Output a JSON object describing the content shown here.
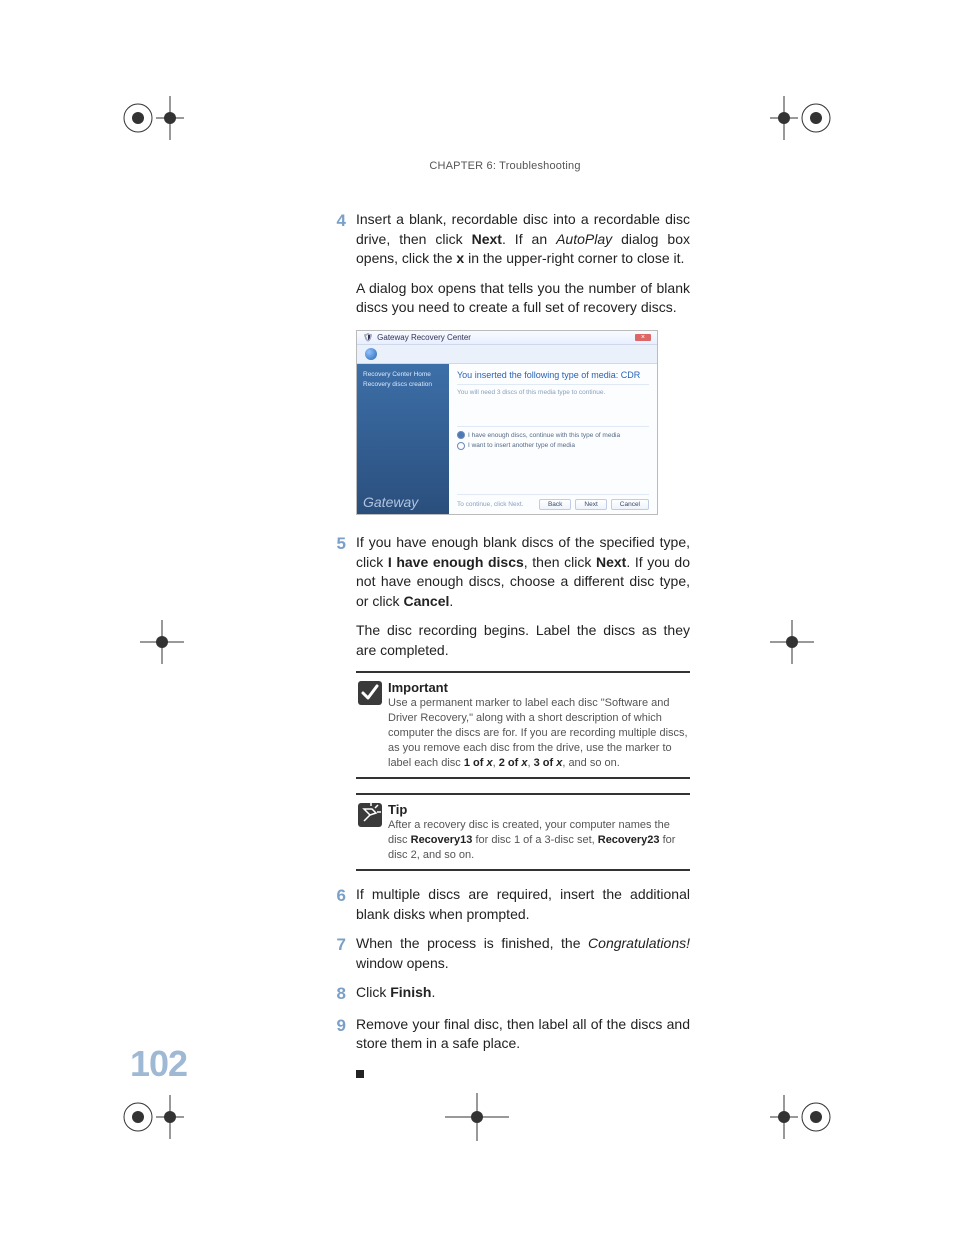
{
  "chapter_header": "CHAPTER 6: Troubleshooting",
  "page_number": "102",
  "steps": {
    "s4": {
      "num": "4",
      "p1a": "Insert a blank, recordable disc into a recordable disc drive, then click ",
      "p1b_bold": "Next",
      "p1c": ". If an ",
      "p1d_italic": "AutoPlay",
      "p1e": " dialog box opens, click the ",
      "p1f_bold": "x",
      "p1g": " in the upper-right corner to close it.",
      "p2": "A dialog box opens that tells you the number of blank discs you need to create a full set of recovery discs."
    },
    "s5": {
      "num": "5",
      "p1a": "If you have enough blank discs of the specified type, click ",
      "p1b_bold": "I have enough discs",
      "p1c": ", then click ",
      "p1d_bold": "Next",
      "p1e": ". If you do not have enough discs, choose a different disc type, or click ",
      "p1f_bold": "Cancel",
      "p1g": ".",
      "p2": "The disc recording begins. Label the discs as they are completed."
    },
    "s6": {
      "num": "6",
      "p1": "If multiple discs are required, insert the additional blank disks when prompted."
    },
    "s7": {
      "num": "7",
      "p1a": "When the process is finished, the ",
      "p1b_italic": "Congratulations!",
      "p1c": " window opens."
    },
    "s8": {
      "num": "8",
      "p1a": "Click ",
      "p1b_bold": "Finish",
      "p1c": "."
    },
    "s9": {
      "num": "9",
      "p1": "Remove your final disc, then label all of the discs and store them in a safe place."
    }
  },
  "callout_important": {
    "title": "Important",
    "body_a": "Use a permanent marker to label each disc \"Software and Driver Recovery,\" along with a short description of which computer the discs are for. If you are recording multiple discs, as you remove each disc from the drive, use the marker to label each disc ",
    "b1": "1 of ",
    "x1": "x",
    "sep1": ", ",
    "b2": "2 of ",
    "x2": "x",
    "sep2": ", ",
    "b3": "3 of ",
    "x3": "x",
    "tail": ", and so on."
  },
  "callout_tip": {
    "title": "Tip",
    "body_a": "After a recovery disc is created, your computer names the disc ",
    "b1": "Recovery13",
    "mid1": " for disc 1 of a 3-disc set, ",
    "b2": "Recovery23",
    "mid2": " for disc 2, and so on."
  },
  "screenshot": {
    "window_title": "Gateway Recovery Center",
    "close": "×",
    "side_item1": "Recovery Center Home",
    "side_item2": "Recovery discs creation",
    "brand": "Gateway",
    "heading": "You inserted the following type of media: CDR",
    "subtext": "You will need 3 discs of this media type to continue.",
    "opt1": "I have enough discs, continue with this type of media",
    "opt2": "I want to insert another type of media",
    "foot_hint": "To continue, click Next.",
    "btn_back": "Back",
    "btn_next": "Next",
    "btn_cancel": "Cancel"
  }
}
